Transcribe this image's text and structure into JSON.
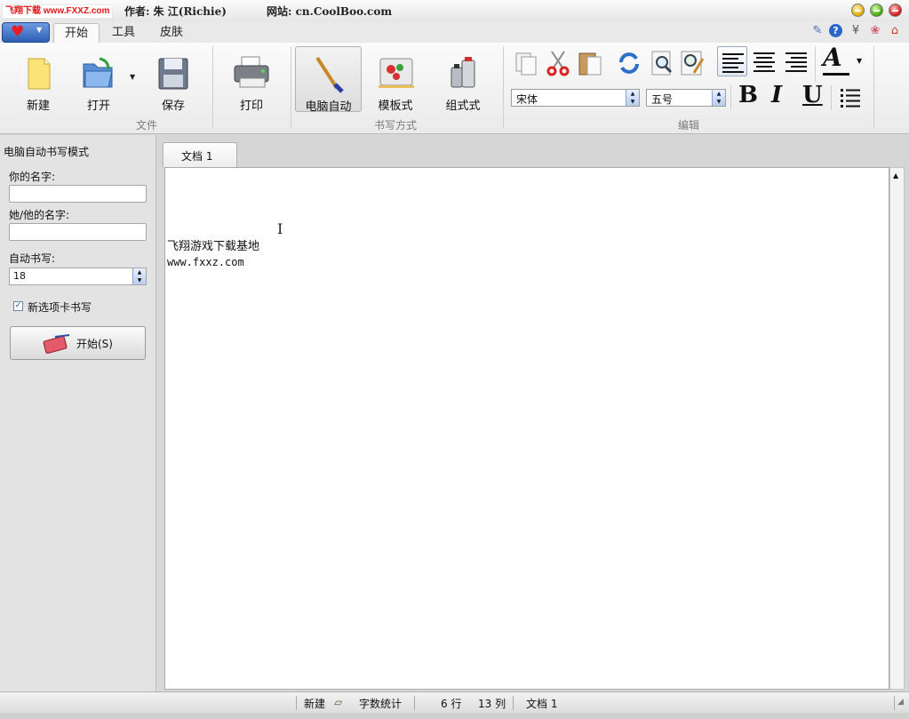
{
  "titlebar": {
    "logo_text": "飞翔下载 www.FXXZ.com",
    "author": "作者: 朱 江(Richie)",
    "website": "网站: cn.CoolBoo.com"
  },
  "ribbon_tabs": [
    "开始",
    "工具",
    "皮肤"
  ],
  "ribbon": {
    "file_group": {
      "label": "文件",
      "new": "新建",
      "open": "打开",
      "save": "保存",
      "print": "打印"
    },
    "mode_group": {
      "label": "书写方式",
      "auto": "电脑自动",
      "template": "模板式",
      "compose": "组式式"
    },
    "edit_group": {
      "label": "编辑",
      "font_name": "宋体",
      "font_size": "五号",
      "bold": "B",
      "italic": "I",
      "underline": "U"
    }
  },
  "side_panel": {
    "title": "电脑自动书写模式",
    "your_name_label": "你的名字:",
    "your_name_value": "",
    "other_name_label": "她/他的名字:",
    "other_name_value": "",
    "auto_write_label": "自动书写:",
    "auto_write_value": "18",
    "new_tab_label": "新选项卡书写",
    "new_tab_checked": true,
    "start_button": "开始(S)"
  },
  "document": {
    "tab_label": "文档 1",
    "lines": [
      "飞翔游戏下载基地",
      "www.fxxz.com"
    ]
  },
  "statusbar": {
    "new": "新建",
    "word_count": "字数统计",
    "row": "6 行",
    "col": "13 列",
    "doc": "文档 1"
  },
  "colors": {
    "accent_blue": "#2d5fb7",
    "heart_red": "#e81c22",
    "ribbon_bg": "#f2f2f2"
  }
}
